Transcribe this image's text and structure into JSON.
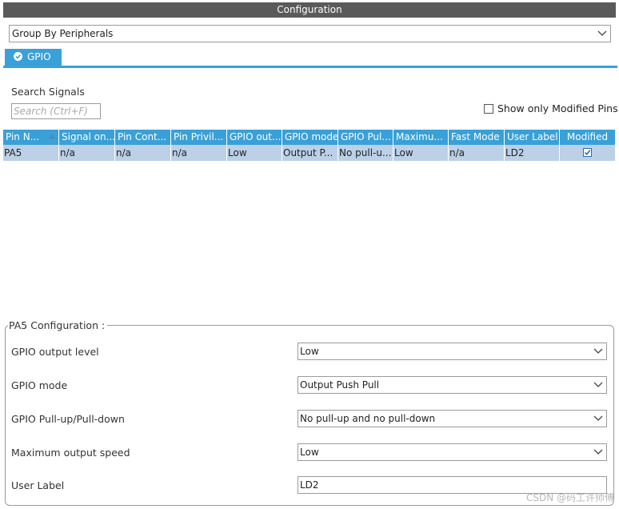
{
  "panel": {
    "title": "Configuration"
  },
  "group_by": {
    "value": "Group By Peripherals"
  },
  "tabs": [
    {
      "label": "GPIO",
      "icon": "check-circle-icon"
    }
  ],
  "search": {
    "label": "Search Signals",
    "placeholder": "Search (Ctrl+F)"
  },
  "filter": {
    "show_modified_label": "Show only Modified Pins",
    "checked": false
  },
  "table": {
    "columns": [
      "Pin N...",
      "Signal on...",
      "Pin Cont...",
      "Pin Privil...",
      "GPIO out...",
      "GPIO mode",
      "GPIO Pul...",
      "Maximu...",
      "Fast Mode",
      "User Label",
      "Modified"
    ],
    "rows": [
      [
        "PA5",
        "n/a",
        "n/a",
        "n/a",
        "Low",
        "Output P...",
        "No pull-u...",
        "Low",
        "n/a",
        "LD2",
        true
      ]
    ]
  },
  "config": {
    "title": "PA5 Configuration :",
    "fields": [
      {
        "label": "GPIO output level",
        "value": "Low",
        "kind": "select"
      },
      {
        "label": "GPIO mode",
        "value": "Output Push Pull",
        "kind": "select"
      },
      {
        "label": "GPIO Pull-up/Pull-down",
        "value": "No pull-up and no pull-down",
        "kind": "select"
      },
      {
        "label": "Maximum output speed",
        "value": "Low",
        "kind": "select"
      },
      {
        "label": "User Label",
        "value": "LD2",
        "kind": "text"
      }
    ]
  },
  "watermark": "CSDN @码工许师傅",
  "colors": {
    "accent": "#3aa0d8",
    "header_bar": "#5a5a5a",
    "selected_row": "#bcd0e8"
  }
}
